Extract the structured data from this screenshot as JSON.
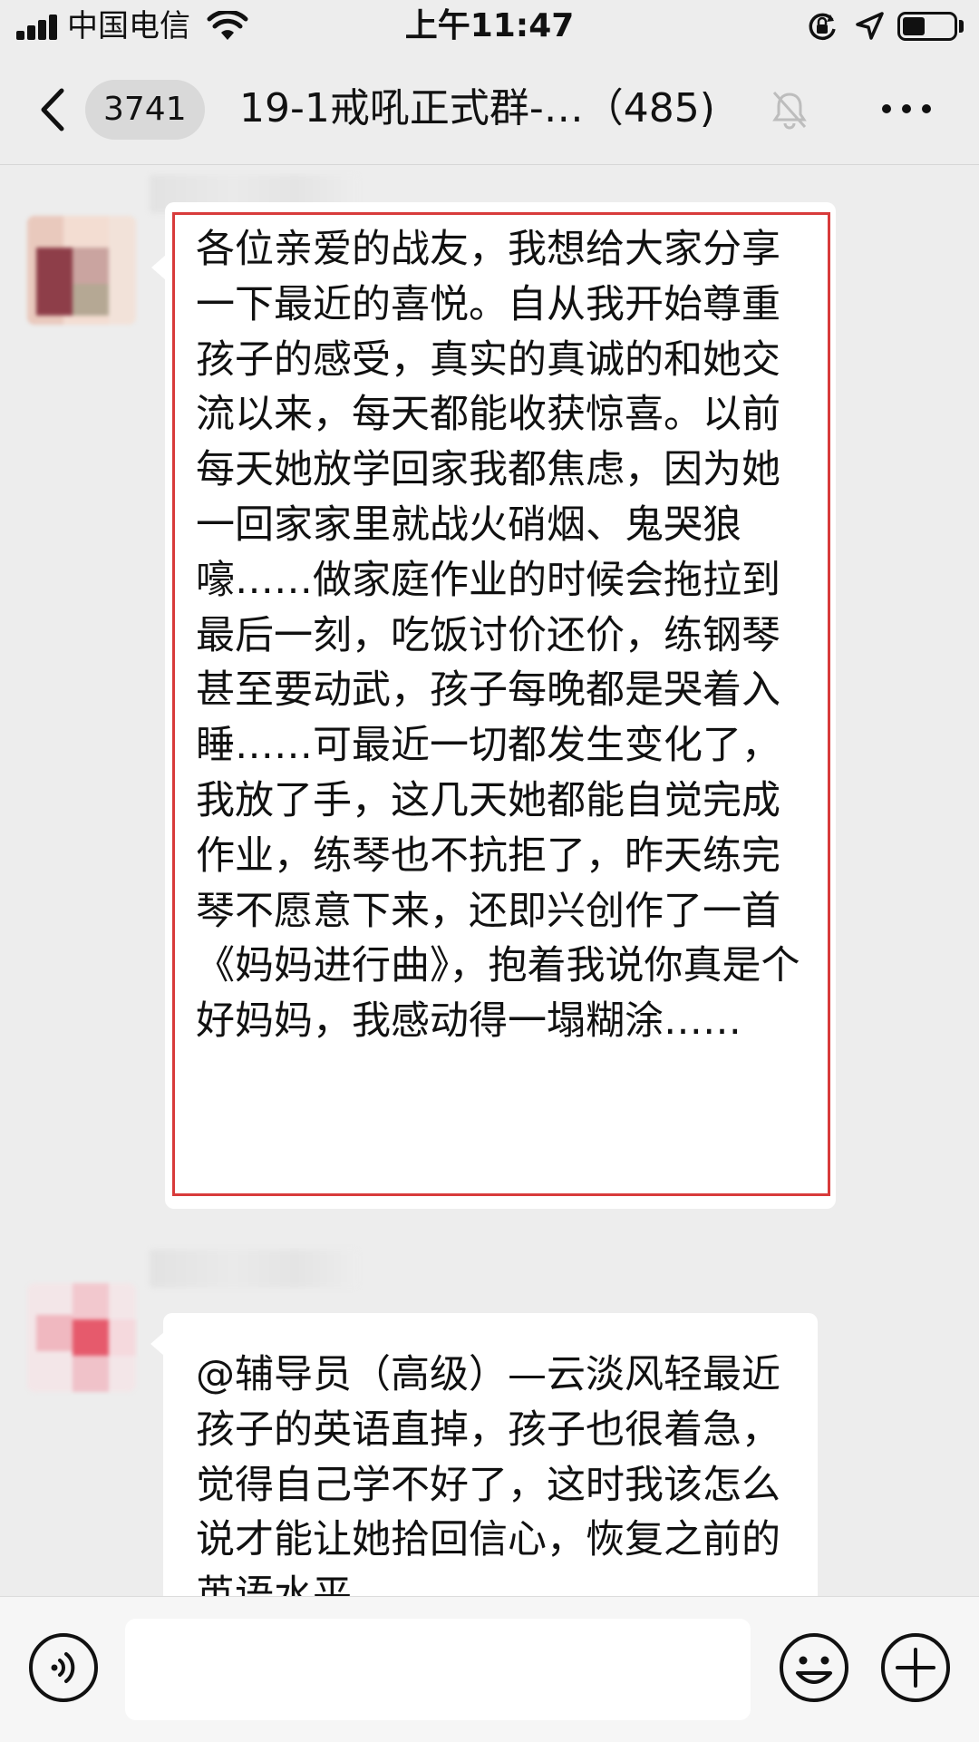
{
  "status_bar": {
    "carrier": "中国电信",
    "time": "上午11:47",
    "battery_level": 0.45,
    "icons": [
      "signal-icon",
      "wifi-icon",
      "orientation-lock-icon",
      "location-icon",
      "battery-icon"
    ]
  },
  "nav": {
    "unread_count": "3741",
    "title": "19-1戒吼正式群-…（485)",
    "icons": [
      "back-chevron-icon",
      "mute-bell-icon",
      "more-dots-icon"
    ]
  },
  "messages": [
    {
      "text": "各位亲爱的战友，我想给大家分享一下最近的喜悦。自从我开始尊重孩子的感受，真实的真诚的和她交流以来，每天都能收获惊喜。以前每天她放学回家我都焦虑，因为她一回家家里就战火硝烟、鬼哭狼嚎……做家庭作业的时候会拖拉到最后一刻，吃饭讨价还价，练钢琴甚至要动武，孩子每晚都是哭着入睡……可最近一切都发生变化了，我放了手，这几天她都能自觉完成作业，练琴也不抗拒了，昨天练完琴不愿意下来，还即兴创作了一首《妈妈进行曲》，抱着我说你真是个好妈妈，我感动得一塌糊涂……",
      "highlighted": true,
      "highlight_color": "#d83b3b"
    },
    {
      "text": "@辅导员（高级）—云淡风轻最近孩子的英语直掉，孩子也很着急，觉得自己学不好了，这时我该怎么说才能让她拾回信心，恢复之前的英语水平",
      "highlighted": false
    }
  ],
  "input_bar": {
    "placeholder": "",
    "icons": [
      "voice-icon",
      "emoji-icon",
      "plus-icon"
    ]
  }
}
